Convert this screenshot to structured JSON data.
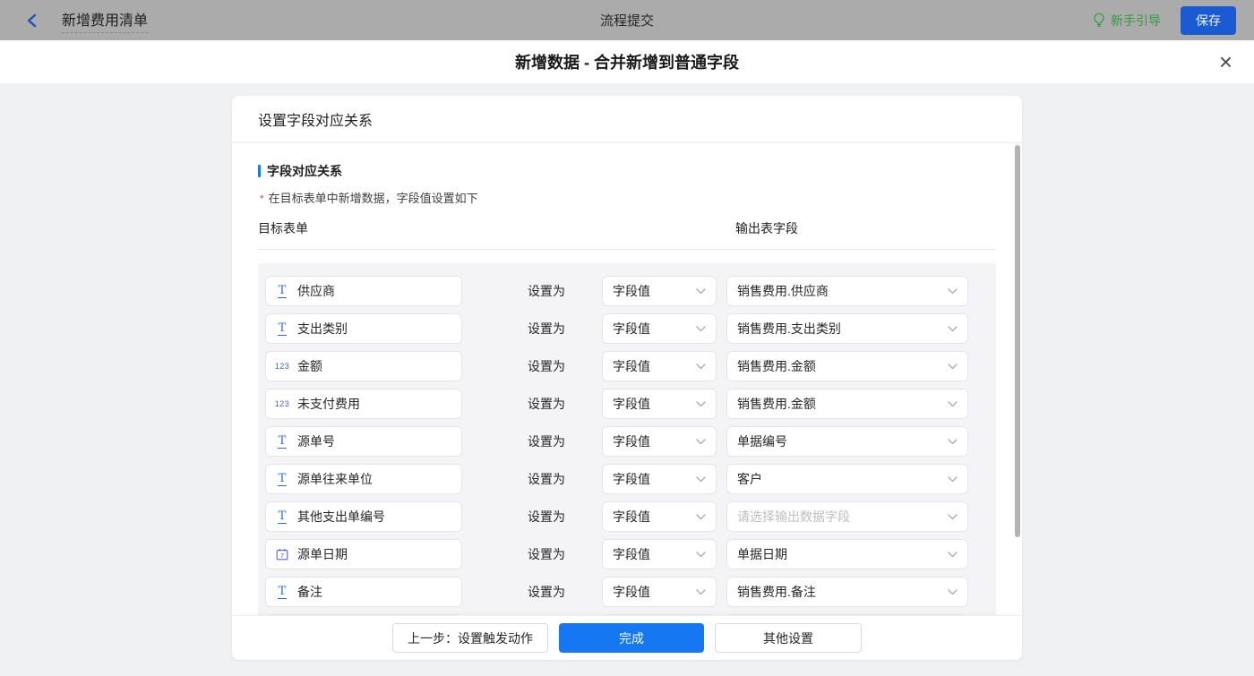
{
  "topbar": {
    "back_title": "新增费用清单",
    "center_title": "流程提交",
    "guide_label": "新手引导",
    "save_label": "保存"
  },
  "modal": {
    "title": "新增数据 - 合并新增到普通字段",
    "close_glyph": "×"
  },
  "panel": {
    "header": "设置字段对应关系",
    "section_title": "字段对应关系",
    "required_mark": "*",
    "section_note": "在目标表单中新增数据，字段值设置如下",
    "col_left": "目标表单",
    "col_right": "输出表字段",
    "set_as_label": "设置为",
    "icon_glyphs": {
      "text": "T",
      "number": "123",
      "date": "7"
    },
    "rows": [
      {
        "field": "供应商",
        "icon": "text",
        "method": "字段值",
        "output": "销售费用.供应商",
        "placeholder": false
      },
      {
        "field": "支出类别",
        "icon": "text",
        "method": "字段值",
        "output": "销售费用.支出类别",
        "placeholder": false
      },
      {
        "field": "金额",
        "icon": "number",
        "method": "字段值",
        "output": "销售费用.金额",
        "placeholder": false
      },
      {
        "field": "未支付费用",
        "icon": "number",
        "method": "字段值",
        "output": "销售费用.金额",
        "placeholder": false
      },
      {
        "field": "源单号",
        "icon": "text",
        "method": "字段值",
        "output": "单据编号",
        "placeholder": false
      },
      {
        "field": "源单往来单位",
        "icon": "text",
        "method": "字段值",
        "output": "客户",
        "placeholder": false
      },
      {
        "field": "其他支出单编号",
        "icon": "text",
        "method": "字段值",
        "output": "请选择输出数据字段",
        "placeholder": true
      },
      {
        "field": "源单日期",
        "icon": "date",
        "method": "字段值",
        "output": "单据日期",
        "placeholder": false
      },
      {
        "field": "备注",
        "icon": "text",
        "method": "字段值",
        "output": "销售费用.备注",
        "placeholder": false
      },
      {
        "field": "",
        "icon": "none",
        "method": "",
        "output": "",
        "placeholder": false
      }
    ]
  },
  "footer": {
    "prev_label": "上一步：设置触发动作",
    "done_label": "完成",
    "other_label": "其他设置"
  },
  "colors": {
    "topbar_bg": "#ababab",
    "guide_green": "#2f9e3d",
    "save_blue": "#1a5ad3",
    "body_bg": "#f0f1f3",
    "section_bar": "#1677ff",
    "accent_blue": "#1677f2",
    "required_red": "#e34d59",
    "icon_blue": "#2e68f0",
    "placeholder_gray": "#bfbfbf"
  }
}
